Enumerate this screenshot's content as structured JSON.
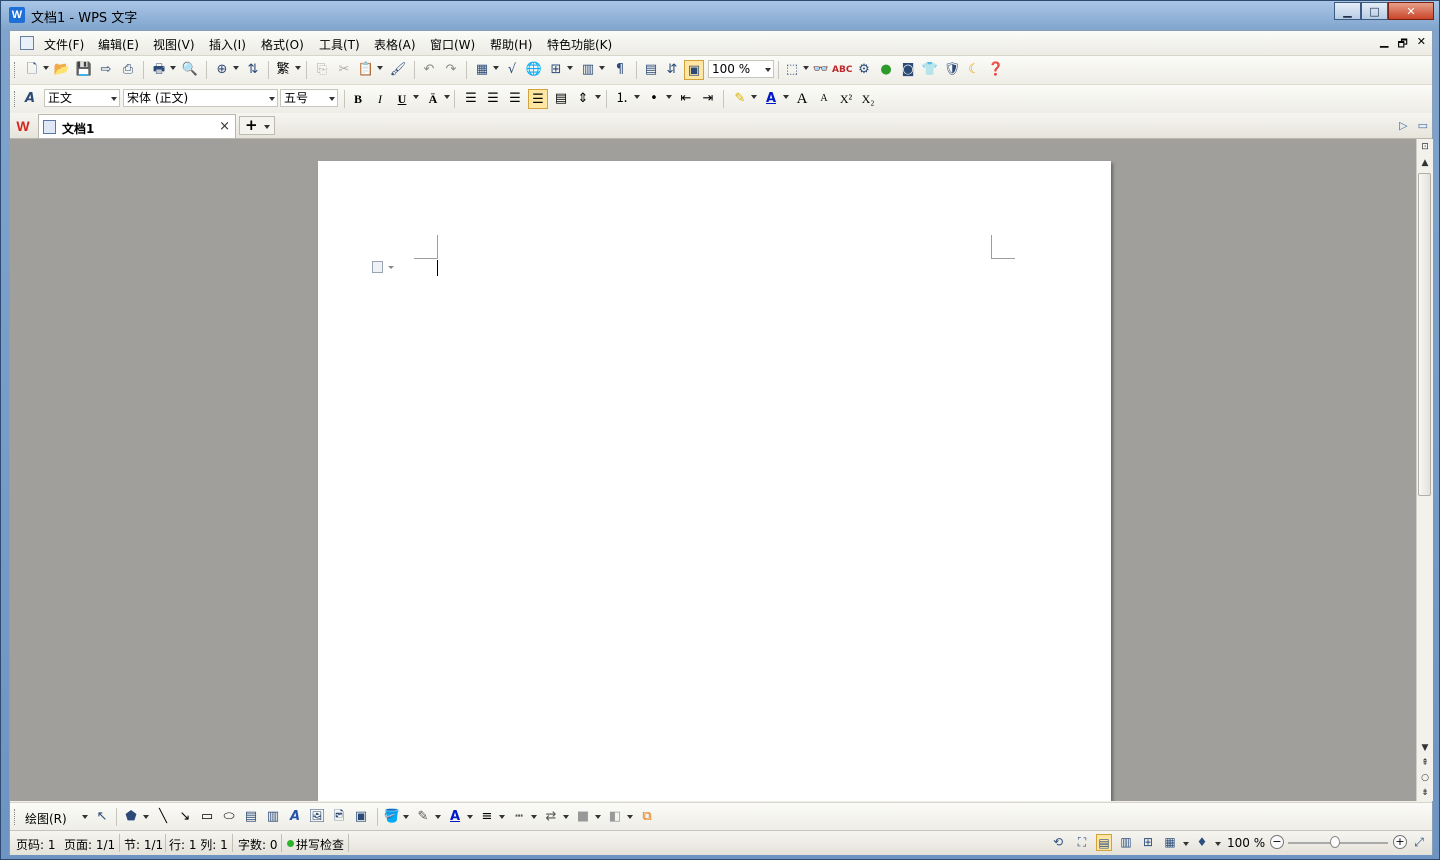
{
  "window": {
    "title": "文档1 - WPS 文字",
    "logo_letter": "W"
  },
  "sys_buttons": {
    "minimize": "▁",
    "maximize": "□",
    "close": "✕"
  },
  "menu": {
    "items": [
      "文件(F)",
      "编辑(E)",
      "视图(V)",
      "插入(I)",
      "格式(O)",
      "工具(T)",
      "表格(A)",
      "窗口(W)",
      "帮助(H)",
      "特色功能(K)"
    ],
    "mdi": [
      "▁",
      "🗗",
      "✕"
    ]
  },
  "standard_toolbar": {
    "traditional_label": "繁",
    "zoom_value": "100 %"
  },
  "format_toolbar": {
    "style_value": "正文",
    "font_value": "宋体 (正文)",
    "size_value": "五号",
    "bold": "B",
    "italic": "I",
    "underline": "U",
    "font_size_big": "A",
    "font_size_small": "A",
    "superscript": "X²",
    "subscript": "X₂"
  },
  "tabbar": {
    "wps_logo": "W",
    "doc_tab_label": "文档1",
    "close": "×",
    "new_tab": "+"
  },
  "drawbar": {
    "draw_label": "绘图(R)"
  },
  "statusbar": {
    "page_num": "页码: 1",
    "page_count": "页面: 1/1",
    "section": "节: 1/1",
    "line_col": "行: 1  列: 1",
    "word_count": "字数: 0",
    "spell_check": "拼写检查",
    "zoom": "100 %"
  },
  "colors": {
    "workspace_bg": "#a09f9b",
    "accent": "#1f6fd8",
    "wps_red": "#d6261e"
  }
}
